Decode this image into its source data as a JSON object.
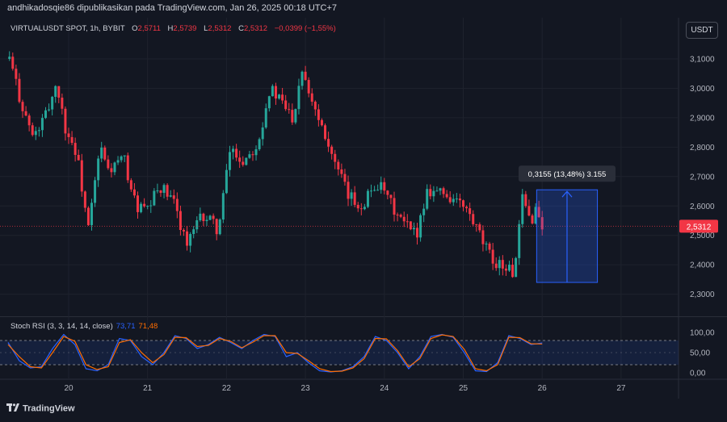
{
  "header": {
    "published_text": "andhikadosqie86 dipublikasikan pada TradingView.com, Jan 26, 2025 00:18 UTC+7"
  },
  "legend": {
    "symbol": "VIRTUALUSDT SPOT, 1h, BYBIT",
    "open_label": "O",
    "open": "2,5711",
    "high_label": "H",
    "high": "2,5739",
    "low_label": "L",
    "low": "2,5312",
    "close_label": "C",
    "close": "2,5312",
    "change": "−0,0399 (−1,55%)"
  },
  "currency_button": "USDT",
  "last_price_tag": "2,5312",
  "measure_label": "0,3155 (13,48%) 3.155",
  "rsi": {
    "label": "Stoch RSI (3, 3, 14, 14, close)",
    "k_value": "73,71",
    "d_value": "71,48"
  },
  "footer": {
    "logo_text": "TradingView"
  },
  "colors": {
    "up": "#26a69a",
    "down": "#f23645",
    "background": "#131722",
    "k_line": "#2962ff",
    "d_line": "#ff6d00",
    "measure": "#2962ff"
  },
  "chart_data": [
    {
      "type": "candlestick",
      "title": "VIRTUALUSDT SPOT, 1h, BYBIT",
      "x_tick_labels": [
        "20",
        "21",
        "22",
        "23",
        "24",
        "25",
        "26",
        "27"
      ],
      "y_tick_labels": [
        "3,1000",
        "3,0000",
        "2,9000",
        "2,8000",
        "2,7000",
        "2,6000",
        "2,5000",
        "2,4000",
        "2,3000"
      ],
      "ylim": [
        2.25,
        3.2
      ],
      "close_path": [
        {
          "day": 19.25,
          "price": 3.1
        },
        {
          "day": 19.4,
          "price": 2.95
        },
        {
          "day": 19.55,
          "price": 2.83
        },
        {
          "day": 19.7,
          "price": 2.9
        },
        {
          "day": 19.85,
          "price": 3.02
        },
        {
          "day": 19.95,
          "price": 2.87
        },
        {
          "day": 20.1,
          "price": 2.78
        },
        {
          "day": 20.25,
          "price": 2.52
        },
        {
          "day": 20.4,
          "price": 2.8
        },
        {
          "day": 20.5,
          "price": 2.72
        },
        {
          "day": 20.7,
          "price": 2.76
        },
        {
          "day": 20.85,
          "price": 2.6
        },
        {
          "day": 21.0,
          "price": 2.58
        },
        {
          "day": 21.15,
          "price": 2.67
        },
        {
          "day": 21.35,
          "price": 2.6
        },
        {
          "day": 21.5,
          "price": 2.47
        },
        {
          "day": 21.7,
          "price": 2.57
        },
        {
          "day": 21.9,
          "price": 2.52
        },
        {
          "day": 22.05,
          "price": 2.8
        },
        {
          "day": 22.2,
          "price": 2.75
        },
        {
          "day": 22.4,
          "price": 2.82
        },
        {
          "day": 22.55,
          "price": 3.0
        },
        {
          "day": 22.7,
          "price": 2.95
        },
        {
          "day": 22.85,
          "price": 2.9
        },
        {
          "day": 22.95,
          "price": 3.08
        },
        {
          "day": 23.1,
          "price": 2.95
        },
        {
          "day": 23.25,
          "price": 2.85
        },
        {
          "day": 23.4,
          "price": 2.72
        },
        {
          "day": 23.55,
          "price": 2.63
        },
        {
          "day": 23.7,
          "price": 2.6
        },
        {
          "day": 23.9,
          "price": 2.68
        },
        {
          "day": 24.05,
          "price": 2.62
        },
        {
          "day": 24.2,
          "price": 2.55
        },
        {
          "day": 24.4,
          "price": 2.5
        },
        {
          "day": 24.55,
          "price": 2.66
        },
        {
          "day": 24.7,
          "price": 2.65
        },
        {
          "day": 24.9,
          "price": 2.62
        },
        {
          "day": 25.05,
          "price": 2.58
        },
        {
          "day": 25.2,
          "price": 2.5
        },
        {
          "day": 25.35,
          "price": 2.42
        },
        {
          "day": 25.5,
          "price": 2.4
        },
        {
          "day": 25.65,
          "price": 2.37
        },
        {
          "day": 25.75,
          "price": 2.62
        },
        {
          "day": 25.85,
          "price": 2.55
        },
        {
          "day": 25.92,
          "price": 2.59
        },
        {
          "day": 26.0,
          "price": 2.5312
        }
      ],
      "last_price": 2.5312,
      "measure": {
        "start_day": 25.93,
        "end_day": 26.7,
        "from_price": 2.34,
        "to_price": 2.655
      }
    },
    {
      "type": "line",
      "title": "Stoch RSI (3, 3, 14, 14, close)",
      "y_tick_labels": [
        "100,00",
        "50,00",
        "0,00"
      ],
      "ylim": [
        0,
        100
      ],
      "bands": [
        80,
        20
      ],
      "series": [
        {
          "name": "K",
          "values": [
            75,
            30,
            12,
            15,
            60,
            95,
            70,
            10,
            5,
            20,
            85,
            80,
            40,
            20,
            50,
            92,
            85,
            60,
            70,
            88,
            75,
            60,
            80,
            95,
            90,
            40,
            50,
            25,
            5,
            2,
            5,
            15,
            40,
            90,
            80,
            50,
            10,
            40,
            90,
            95,
            88,
            50,
            5,
            3,
            25,
            92,
            85,
            70,
            73.71
          ]
        },
        {
          "name": "D",
          "values": [
            70,
            40,
            15,
            12,
            50,
            90,
            78,
            20,
            8,
            15,
            75,
            82,
            50,
            25,
            45,
            88,
            87,
            65,
            68,
            85,
            78,
            62,
            76,
            92,
            92,
            50,
            48,
            30,
            10,
            3,
            4,
            12,
            35,
            85,
            84,
            55,
            15,
            35,
            85,
            94,
            90,
            58,
            10,
            5,
            20,
            88,
            87,
            72,
            71.48
          ]
        }
      ]
    }
  ]
}
